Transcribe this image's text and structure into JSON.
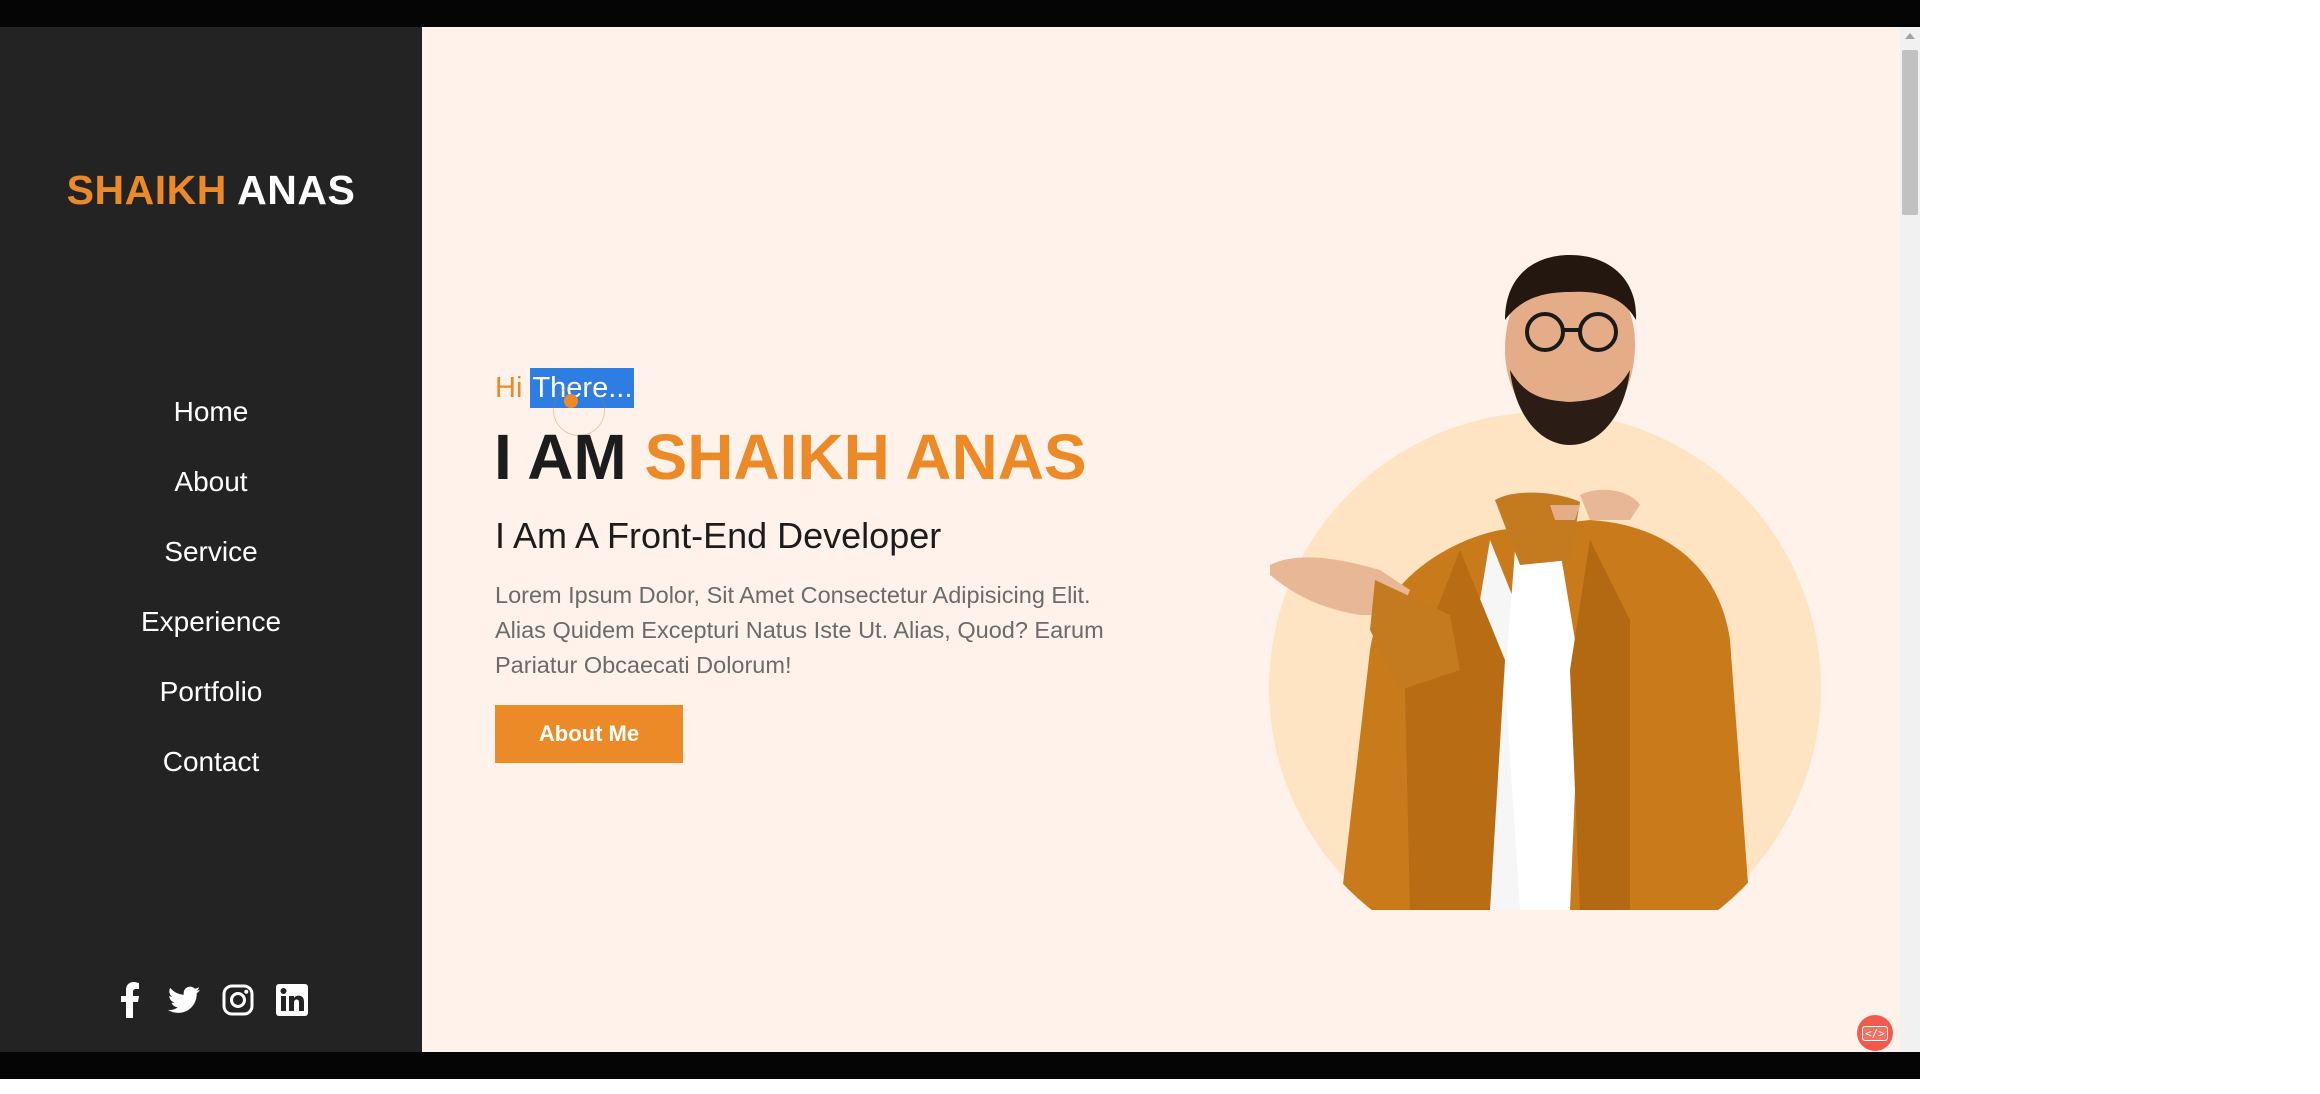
{
  "sidebar": {
    "logo_first": "SHAIKH",
    "logo_second": " ANAS",
    "nav": [
      {
        "label": "Home"
      },
      {
        "label": "About"
      },
      {
        "label": "Service"
      },
      {
        "label": "Experience"
      },
      {
        "label": "Portfolio"
      },
      {
        "label": "Contact"
      }
    ],
    "social_icons": [
      "facebook-icon",
      "twitter-icon",
      "instagram-icon",
      "linkedin-icon"
    ]
  },
  "hero": {
    "greeting_plain": "Hi ",
    "greeting_selected": "There...",
    "title_plain": "I AM ",
    "title_accent": "SHAIKH ANAS",
    "subtitle": "I Am A Front-End Developer",
    "description": "Lorem Ipsum Dolor, Sit Amet Consectetur Adipisicing Elit. Alias Quidem Excepturi Natus Iste Ut. Alias, Quod? Earum Pariatur Obcaecati Dolorum!",
    "button_label": "About Me"
  },
  "fab_icon": "</>",
  "colors": {
    "accent": "#ec8a27",
    "sidebar_bg": "#232323",
    "main_bg": "#fff2ea",
    "selection": "#2d7de3"
  }
}
